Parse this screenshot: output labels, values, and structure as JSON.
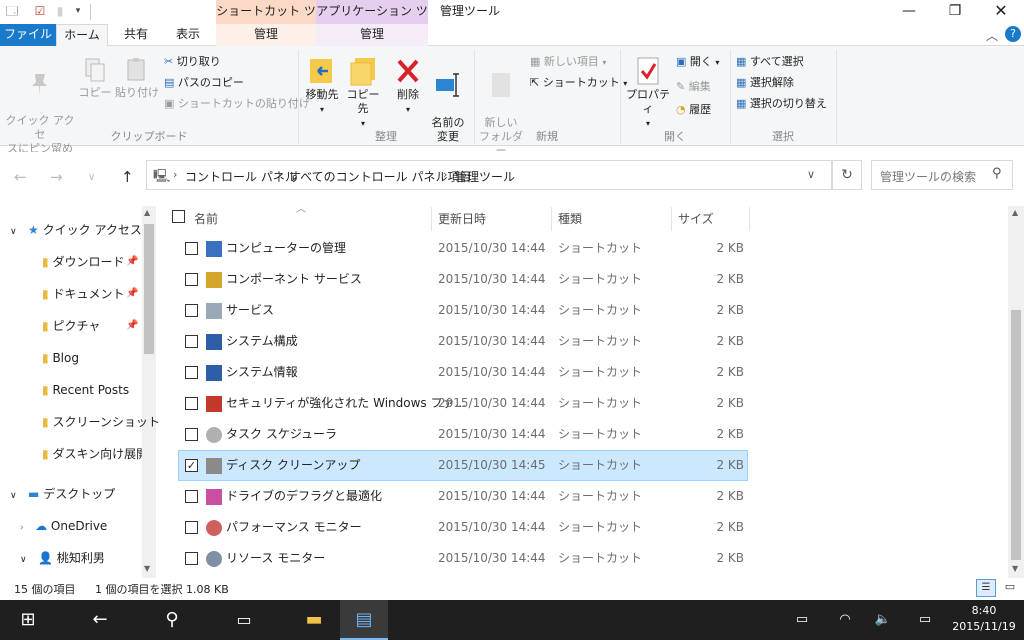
{
  "window": {
    "title": "管理ツール",
    "context_tabs": [
      "ショートカット ツール",
      "アプリケーション ツール"
    ]
  },
  "tabs": {
    "file": "ファイル",
    "home": "ホーム",
    "share": "共有",
    "view": "表示",
    "manage1": "管理",
    "manage2": "管理"
  },
  "ribbon": {
    "clipboard": {
      "label": "クリップボード",
      "pin_quick": "クイック アクセ\nスにピン留め",
      "copy": "コピー",
      "paste": "貼り付け",
      "cut": "切り取り",
      "copy_path": "パスのコピー",
      "paste_shortcut": "ショートカットの貼り付け"
    },
    "organize": {
      "label": "整理",
      "move_to": "移動先",
      "copy_to": "コピー先",
      "delete": "削除",
      "rename": "名前の\n変更"
    },
    "new": {
      "label": "新規",
      "new_folder": "新しい\nフォルダー",
      "new_item": "新しい項目",
      "shortcut": "ショートカット"
    },
    "open": {
      "label": "開く",
      "properties": "プロパティ",
      "open": "開く",
      "edit": "編集",
      "history": "履歴"
    },
    "select": {
      "label": "選択",
      "select_all": "すべて選択",
      "select_none": "選択解除",
      "invert": "選択の切り替え"
    }
  },
  "address": {
    "crumbs": [
      "コントロール パネル",
      "すべてのコントロール パネル項目",
      "管理ツール"
    ],
    "search_placeholder": "管理ツールの検索"
  },
  "sidebar": {
    "items": [
      {
        "label": "クイック アクセス",
        "icon": "star-icon"
      },
      {
        "label": "ダウンロード",
        "icon": "download-folder-icon"
      },
      {
        "label": "ドキュメント",
        "icon": "documents-folder-icon"
      },
      {
        "label": "ピクチャ",
        "icon": "pictures-folder-icon"
      },
      {
        "label": "Blog",
        "icon": "user-folder-icon"
      },
      {
        "label": "Recent Posts",
        "icon": "folder-icon"
      },
      {
        "label": "スクリーンショット",
        "icon": "folder-icon"
      },
      {
        "label": "ダスキン向け展開",
        "icon": "folder-icon"
      },
      {
        "label": "デスクトップ",
        "icon": "desktop-icon"
      },
      {
        "label": "OneDrive",
        "icon": "onedrive-icon"
      },
      {
        "label": "桃知利男",
        "icon": "user-icon"
      }
    ]
  },
  "columns": {
    "name": "名前",
    "modified": "更新日時",
    "type": "種類",
    "size": "サイズ"
  },
  "files": [
    {
      "name": "コンピューターの管理",
      "date": "2015/10/30 14:44",
      "type": "ショートカット",
      "size": "2 KB",
      "checked": false
    },
    {
      "name": "コンポーネント サービス",
      "date": "2015/10/30 14:44",
      "type": "ショートカット",
      "size": "2 KB",
      "checked": false
    },
    {
      "name": "サービス",
      "date": "2015/10/30 14:44",
      "type": "ショートカット",
      "size": "2 KB",
      "checked": false
    },
    {
      "name": "システム構成",
      "date": "2015/10/30 14:44",
      "type": "ショートカット",
      "size": "2 KB",
      "checked": false
    },
    {
      "name": "システム情報",
      "date": "2015/10/30 14:44",
      "type": "ショートカット",
      "size": "2 KB",
      "checked": false
    },
    {
      "name": "セキュリティが強化された Windows ファ...",
      "date": "2015/10/30 14:44",
      "type": "ショートカット",
      "size": "2 KB",
      "checked": false
    },
    {
      "name": "タスク スケジューラ",
      "date": "2015/10/30 14:44",
      "type": "ショートカット",
      "size": "2 KB",
      "checked": false
    },
    {
      "name": "ディスク クリーンアップ",
      "date": "2015/10/30 14:45",
      "type": "ショートカット",
      "size": "2 KB",
      "checked": true
    },
    {
      "name": "ドライブのデフラグと最適化",
      "date": "2015/10/30 14:44",
      "type": "ショートカット",
      "size": "2 KB",
      "checked": false
    },
    {
      "name": "パフォーマンス モニター",
      "date": "2015/10/30 14:44",
      "type": "ショートカット",
      "size": "2 KB",
      "checked": false
    },
    {
      "name": "リソース モニター",
      "date": "2015/10/30 14:44",
      "type": "ショートカット",
      "size": "2 KB",
      "checked": false
    }
  ],
  "status": {
    "count": "15 個の項目",
    "selection": "1 個の項目を選択 1.08 KB"
  },
  "taskbar": {
    "time": "8:40",
    "date": "2015/11/19"
  }
}
